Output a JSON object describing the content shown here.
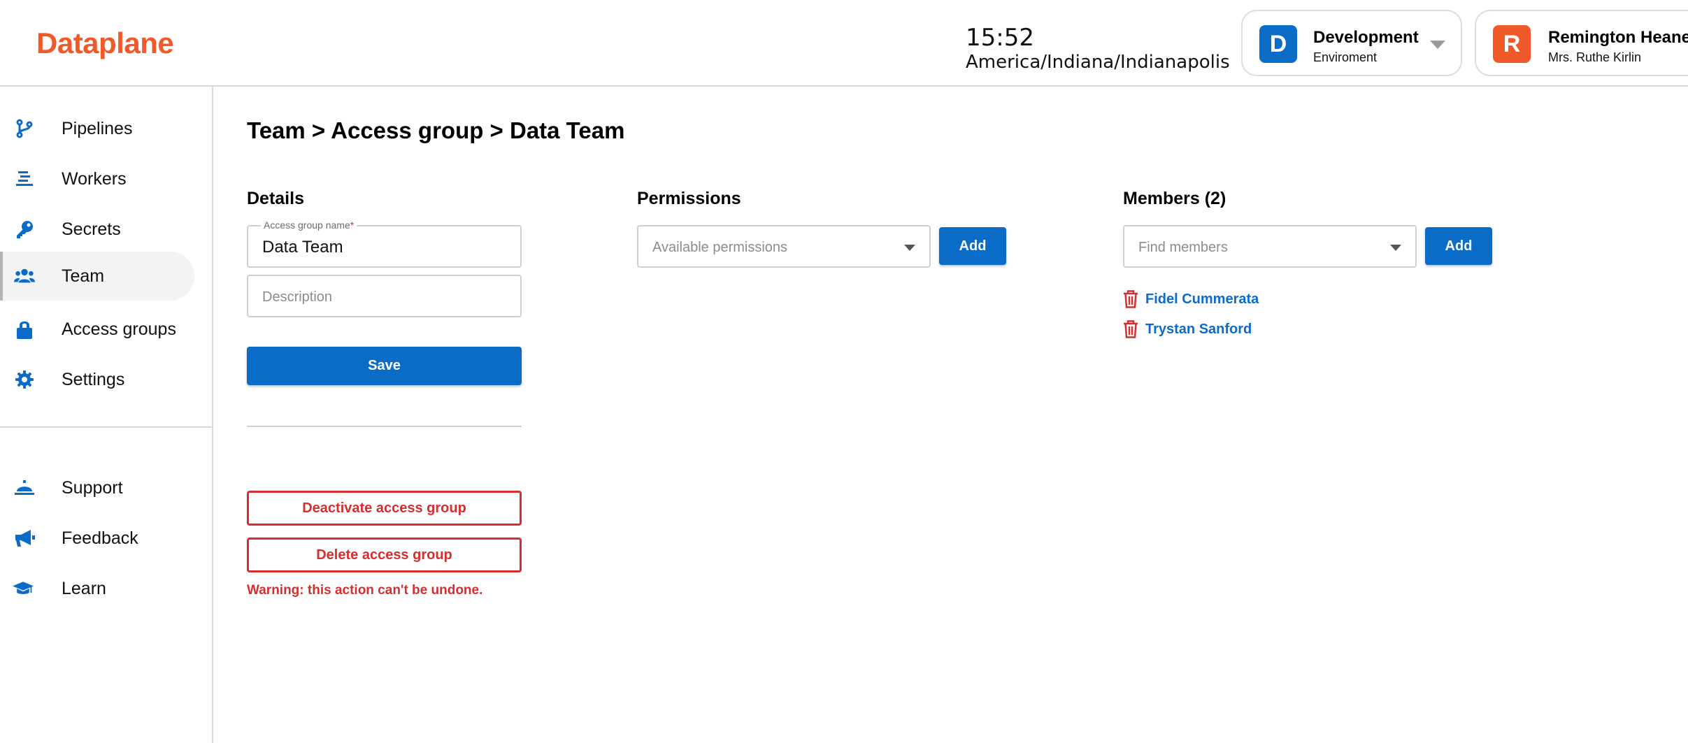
{
  "app": {
    "brand": "Dataplane",
    "brand_color": "#f05a28",
    "accent_color": "#0a6cc7",
    "danger_color": "#d32f2f"
  },
  "header": {
    "time": "15:52",
    "timezone": "America/Indiana/Indianapolis",
    "environment": {
      "initial": "D",
      "name": "Development",
      "label": "Enviroment"
    },
    "user": {
      "initial": "R",
      "name": "Remington Heaney",
      "subtitle": "Mrs. Ruthe Kirlin"
    }
  },
  "sidebar": {
    "items": [
      {
        "label": "Pipelines",
        "icon": "pipelines-icon"
      },
      {
        "label": "Workers",
        "icon": "workers-icon"
      },
      {
        "label": "Secrets",
        "icon": "key-icon"
      },
      {
        "label": "Team",
        "icon": "team-icon",
        "active": true
      },
      {
        "label": "Access groups",
        "icon": "lock-icon"
      },
      {
        "label": "Settings",
        "icon": "gear-icon"
      }
    ],
    "secondary": [
      {
        "label": "Support",
        "icon": "bell-icon"
      },
      {
        "label": "Feedback",
        "icon": "megaphone-icon"
      },
      {
        "label": "Learn",
        "icon": "graduation-cap-icon"
      }
    ]
  },
  "page": {
    "breadcrumb": "Team > Access group > Data Team",
    "details": {
      "title": "Details",
      "name_label": "Access group name",
      "name_required_mark": "*",
      "name_value": "Data Team",
      "description_placeholder": "Description",
      "save_label": "Save",
      "deactivate_label": "Deactivate access group",
      "delete_label": "Delete access group",
      "warning": "Warning: this action can't be undone."
    },
    "permissions": {
      "title": "Permissions",
      "select_placeholder": "Available permissions",
      "add_label": "Add"
    },
    "members": {
      "title": "Members (2)",
      "select_placeholder": "Find members",
      "add_label": "Add",
      "list": [
        "Fidel Cummerata",
        "Trystan Sanford"
      ]
    }
  }
}
